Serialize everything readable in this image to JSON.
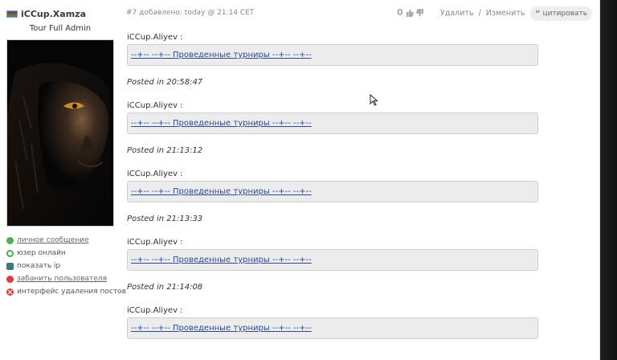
{
  "author": {
    "name": "iCCup.Xamza",
    "rank": "Tour Full Admin"
  },
  "actions": [
    {
      "label": "личное сообщение",
      "icon": "message-icon",
      "link": true
    },
    {
      "label": "юзер онлайн",
      "icon": "online-status-icon",
      "link": false
    },
    {
      "label": "показать ip",
      "icon": "ip-icon",
      "link": false
    },
    {
      "label": "забанить пользователя",
      "icon": "ban-icon",
      "link": true
    },
    {
      "label": "интерфейс удаления постов",
      "icon": "delete-icon",
      "link": false
    }
  ],
  "post": {
    "meta": "#7 добавлено: today @ 21:14 CET",
    "score": "0",
    "delete_label": "Удалить",
    "separator": "/",
    "edit_label": "Изменить",
    "quote_label": "цитировать"
  },
  "entries": [
    {
      "quote_author": "iCCup.Aliyev :",
      "link_text": "--+-- --+-- Проведенные турниры --+-- --+--",
      "posted": "Posted in 20:58:47"
    },
    {
      "quote_author": "iCCup.Aliyev :",
      "link_text": "--+-- --+-- Проведенные турниры --+-- --+--",
      "posted": "Posted in 21:13:12"
    },
    {
      "quote_author": "iCCup.Aliyev :",
      "link_text": "--+-- --+-- Проведенные турниры --+-- --+--",
      "posted": "Posted in 21:13:33"
    },
    {
      "quote_author": "iCCup.Aliyev :",
      "link_text": "--+-- --+-- Проведенные турниры --+-- --+--",
      "posted": "Posted in 21:14:08"
    },
    {
      "quote_author": "iCCup.Aliyev :",
      "link_text": "--+-- --+-- Проведенные турниры --+-- --+--",
      "posted": ""
    }
  ],
  "colors": {
    "link": "#2a4b9a",
    "quote_bg": "#ececec",
    "online": "#4caf50",
    "danger": "#e53935"
  }
}
